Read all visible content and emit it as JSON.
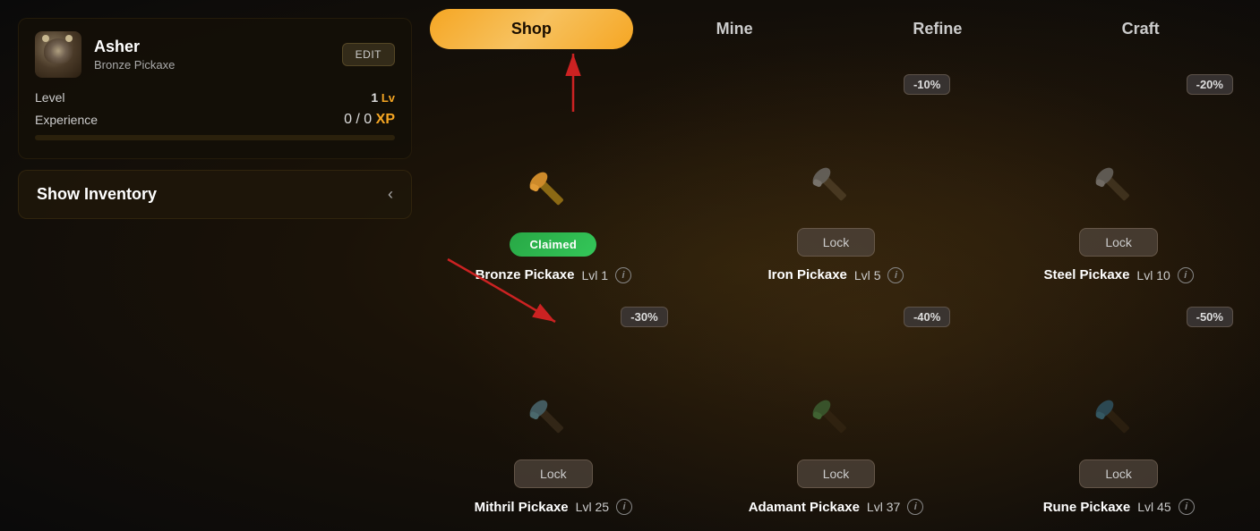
{
  "background": {
    "color": "#1a1208"
  },
  "profile": {
    "username": "Asher",
    "pickaxe": "Bronze Pickaxe",
    "edit_label": "EDIT",
    "level_label": "Level",
    "level_value": "1",
    "level_unit": "Lv",
    "experience_label": "Experience",
    "experience_value": "0 / 0",
    "experience_unit": "XP",
    "exp_percent": 0
  },
  "inventory": {
    "toggle_label": "Show Inventory",
    "chevron": "‹"
  },
  "nav": {
    "tabs": [
      {
        "id": "shop",
        "label": "Shop",
        "active": true
      },
      {
        "id": "mine",
        "label": "Mine",
        "active": false
      },
      {
        "id": "refine",
        "label": "Refine",
        "active": false
      },
      {
        "id": "craft",
        "label": "Craft",
        "active": false
      }
    ]
  },
  "shop": {
    "items": [
      {
        "id": "bronze-pickaxe",
        "name": "Bronze Pickaxe",
        "level_label": "Lvl",
        "level": "1",
        "status": "claimed",
        "claimed_label": "Claimed",
        "has_discount": false,
        "discount": "",
        "locked": false
      },
      {
        "id": "iron-pickaxe",
        "name": "Iron Pickaxe",
        "level_label": "Lvl",
        "level": "5",
        "status": "locked",
        "has_discount": true,
        "discount": "-10%",
        "locked": true,
        "lock_label": "Lock"
      },
      {
        "id": "steel-pickaxe",
        "name": "Steel Pickaxe",
        "level_label": "Lvl",
        "level": "10",
        "status": "locked",
        "has_discount": true,
        "discount": "-20%",
        "locked": true,
        "lock_label": "Lock"
      },
      {
        "id": "mithril-pickaxe",
        "name": "Mithril Pickaxe",
        "level_label": "Lvl",
        "level": "25",
        "status": "locked",
        "has_discount": true,
        "discount": "-30%",
        "locked": true,
        "lock_label": "Lock"
      },
      {
        "id": "adamant-pickaxe",
        "name": "Adamant Pickaxe",
        "level_label": "Lvl",
        "level": "37",
        "status": "locked",
        "has_discount": true,
        "discount": "-40%",
        "locked": true,
        "lock_label": "Lock"
      },
      {
        "id": "rune-pickaxe",
        "name": "Rune Pickaxe",
        "level_label": "Lvl",
        "level": "45",
        "status": "locked",
        "has_discount": true,
        "discount": "-50%",
        "locked": true,
        "lock_label": "Lock"
      }
    ]
  },
  "arrows": [
    {
      "id": "arrow-shop",
      "label": "arrow pointing to Shop tab"
    },
    {
      "id": "arrow-claimed",
      "label": "arrow pointing to Claimed button"
    }
  ]
}
